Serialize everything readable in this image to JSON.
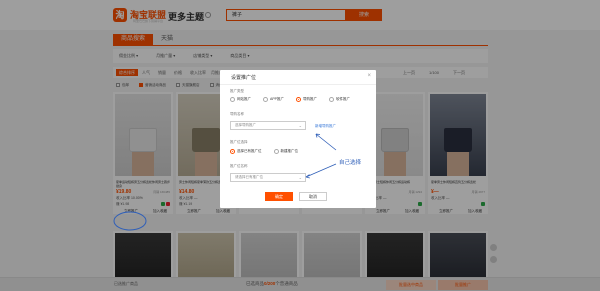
{
  "header": {
    "logo_mark": "淘",
    "logo_text": "淘宝联盟",
    "logo_sub": "阿里巴巴旗下营销平台",
    "more_topics": "更多主题",
    "search_value": "裤子",
    "search_button": "搜索"
  },
  "tabs": [
    "商品搜索",
    "天猫"
  ],
  "filters": [
    "佣金比例 ▾",
    "月推广量 ▾",
    "店铺类型 ▾",
    "商品类目 ▾"
  ],
  "sort": {
    "active": "综合排序",
    "items": [
      "人气",
      "销量",
      "价格",
      "收入比率",
      "月推广"
    ],
    "pager": [
      "上一页",
      "1/100",
      "下一页"
    ]
  },
  "options": [
    "包邮",
    "营销活动商品",
    "天猫旗舰店",
    "消费者保障",
    "货到付款",
    "优惠券商品",
    "超级高佣"
  ],
  "cards": [
    {
      "title": "夏季运动短裤男五分裤宽松休闲男士跑步健身",
      "price": "¥19.80",
      "sales": "月销 166485",
      "ratio": "收入比率 10.00%",
      "store": "赚 ¥1.98",
      "promo": "立即推广",
      "collect": "加入收藏"
    },
    {
      "title": "男士休闲短裤夏季薄款五分裤宽松",
      "price": "¥14.80",
      "sales": "月销 —",
      "ratio": "收入比率 —",
      "store": "赚 ¥1.19",
      "promo": "立即推广",
      "collect": "加入收藏"
    },
    {
      "title": "冰丝短裤男夏季薄款五分裤",
      "price": "¥—",
      "sales": "",
      "ratio": "",
      "store": "",
      "promo": "",
      "collect": ""
    },
    {
      "title": "",
      "price": "",
      "sales": "",
      "ratio": "",
      "store": "",
      "promo": "",
      "collect": ""
    },
    {
      "title": "夏季男士短裤休闲五分裤运动裤",
      "price": "¥—",
      "sales": "月销 1294",
      "ratio": "收入比率 —",
      "store": "",
      "promo": "立即推广",
      "collect": "加入收藏"
    },
    {
      "title": "夏季男士休闲短裤直筒五分裤宽松",
      "price": "¥—",
      "sales": "月销 4977",
      "ratio": "收入比率 —",
      "store": "",
      "promo": "立即推广",
      "collect": "加入收藏"
    }
  ],
  "modal": {
    "title": "设置推广位",
    "close": "×",
    "type_label": "推广类型",
    "types": [
      "网站推广",
      "APP推广",
      "导购推广",
      "软件推广"
    ],
    "site_label": "导购名称",
    "site_placeholder": "选择导购推广",
    "new_link": "新增导购推广",
    "pos_label": "推广位选择",
    "pos_options": [
      "选择已有推广位",
      "新建推广位"
    ],
    "pos_placeholder": "选择已有推广位",
    "id_label": "推广位名称",
    "id_placeholder": "请选择已有推广位",
    "ok": "确定",
    "cancel": "取消"
  },
  "annotation": "自己选择",
  "bottombar": {
    "left": "已选推广商品",
    "center_prefix": "已选商品",
    "center_count": "0/200",
    "center_suffix": "个普通商品",
    "btn1": "批量选中商品",
    "btn2": "批量推广"
  },
  "colors": {
    "accent": "#ff5000",
    "annotation": "#2f5fb8"
  }
}
